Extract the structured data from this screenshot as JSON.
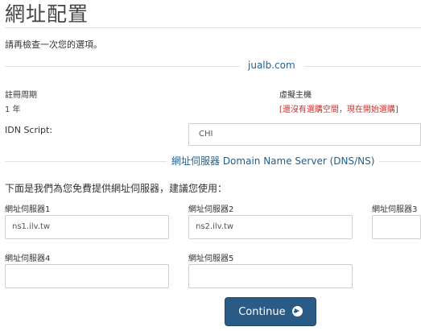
{
  "page": {
    "title": "網址配置",
    "subtitle": "請再檢查一次您的選項。"
  },
  "domain": {
    "name": "jualb.com"
  },
  "registration": {
    "period_label": "註冊周期",
    "period_value": "1 年",
    "hosting_label": "虛擬主機",
    "hosting_value": "[還沒有選購空間，現在開始選購]"
  },
  "idn": {
    "label": "IDN Script:",
    "selected": "CHI"
  },
  "nameservers": {
    "heading": "網址伺服器 Domain Name Server (DNS/NS)",
    "intro": "下面是我們為您免費提供網址伺服器，建議您使用：",
    "fields": [
      {
        "label": "網址伺服器1",
        "value": "ns1.ilv.tw"
      },
      {
        "label": "網址伺服器2",
        "value": "ns2.ilv.tw"
      },
      {
        "label": "網址伺服器3",
        "value": ""
      },
      {
        "label": "網址伺服器4",
        "value": ""
      },
      {
        "label": "網址伺服器5",
        "value": ""
      }
    ]
  },
  "actions": {
    "continue_label": "Continue"
  },
  "colors": {
    "accent": "#2a5a86",
    "heading_blue": "#1f5f8b",
    "warning": "#c9302c"
  },
  "icons": {
    "continue": "arrow-right-circle-icon"
  }
}
